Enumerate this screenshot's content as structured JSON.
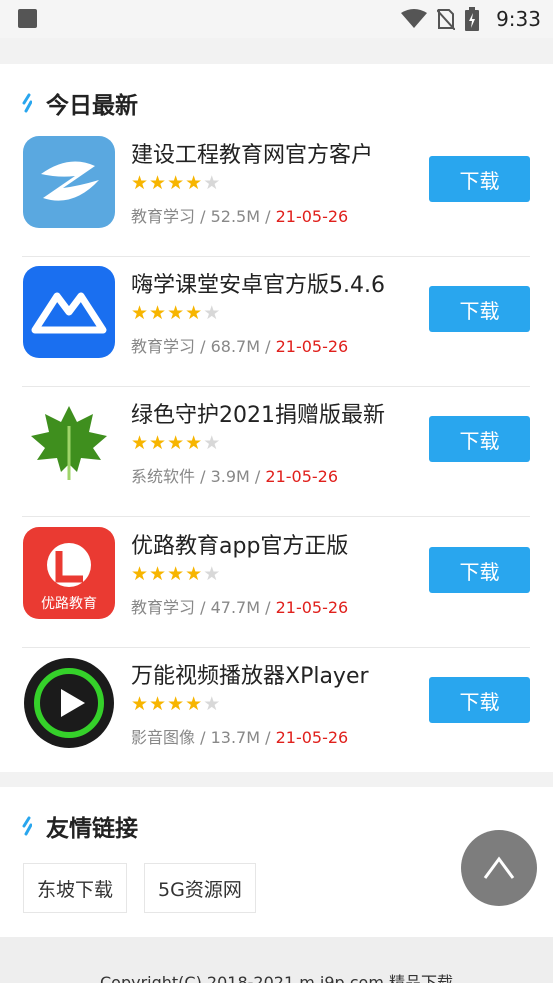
{
  "status_bar": {
    "time": "9:33",
    "icons": [
      "notification-square-icon",
      "wifi-icon",
      "no-sim-icon",
      "battery-charging-icon"
    ]
  },
  "today_section": {
    "title": "今日最新",
    "apps": [
      {
        "name": "建设工程教育网官方客户",
        "rating": 4,
        "category": "教育学习",
        "size": "52.5M",
        "date": "21-05-26",
        "button": "下载",
        "icon": "jianshe-app-icon"
      },
      {
        "name": "嗨学课堂安卓官方版5.4.6",
        "rating": 4,
        "category": "教育学习",
        "size": "68.7M",
        "date": "21-05-26",
        "button": "下载",
        "icon": "haixue-app-icon"
      },
      {
        "name": "绿色守护2021捐赠版最新",
        "rating": 4,
        "category": "系统软件",
        "size": "3.9M",
        "date": "21-05-26",
        "button": "下载",
        "icon": "greenify-app-icon"
      },
      {
        "name": "优路教育app官方正版",
        "rating": 4,
        "category": "教育学习",
        "size": "47.7M",
        "date": "21-05-26",
        "button": "下载",
        "icon": "youlu-app-icon"
      },
      {
        "name": "万能视频播放器XPlayer",
        "rating": 4,
        "category": "影音图像",
        "size": "13.7M",
        "date": "21-05-26",
        "button": "下载",
        "icon": "xplayer-app-icon"
      }
    ],
    "separator": " / "
  },
  "links_section": {
    "title": "友情链接",
    "links": [
      "东坡下载",
      "5G资源网"
    ]
  },
  "youlu_icon_text": "优路教育",
  "footer": {
    "copyright": "Copyright(C) 2018-2021 m.i9p.com 精品下载"
  },
  "colors": {
    "accent": "#29a6ee",
    "date": "#e0201c",
    "star": "#f7b500"
  }
}
